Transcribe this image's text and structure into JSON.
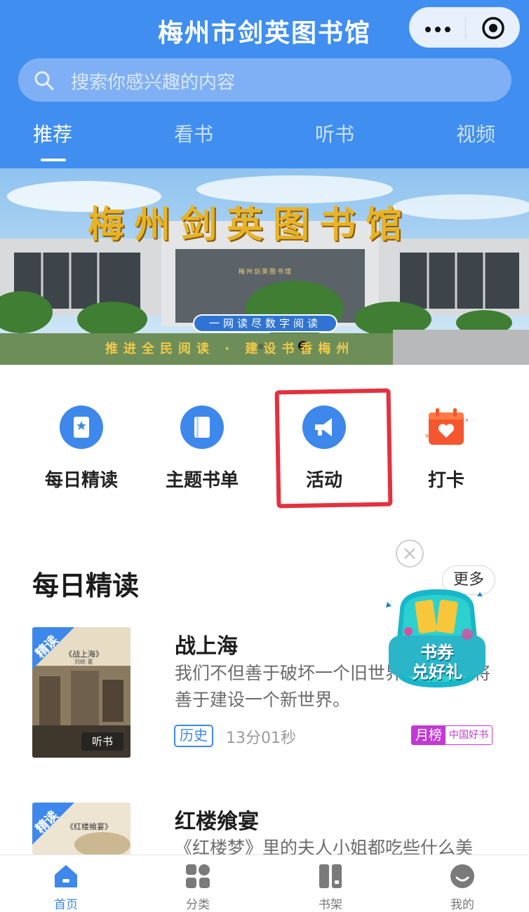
{
  "header": {
    "title": "梅州市剑英图书馆",
    "search_placeholder": "搜索你感兴趣的内容",
    "tabs": [
      "推荐",
      "看书",
      "听书",
      "视频"
    ],
    "active_tab": "推荐",
    "accent_color": "#3f8ef0"
  },
  "banner": {
    "headline": "梅州剑英图书馆",
    "building_sign": "梅州剑英图书馆",
    "pill": "一网读尽数字阅读",
    "slogan": "推进全民阅读 · 建设书香梅州"
  },
  "quick_links": [
    {
      "label": "每日精读",
      "icon": "book-star-icon"
    },
    {
      "label": "主题书单",
      "icon": "book-icon"
    },
    {
      "label": "活动",
      "icon": "megaphone-icon"
    },
    {
      "label": "打卡",
      "icon": "calendar-heart-icon"
    }
  ],
  "section": {
    "title": "每日精读",
    "more_label": "更多"
  },
  "books": [
    {
      "title": "战上海",
      "description": "我们不但善于破坏一个旧世界，我们还将善于建设一个新世界。",
      "ribbon": "精读",
      "cover_title": "《战上海》",
      "cover_author": "刘统 著",
      "cover_badge": "听书",
      "tag": "历史",
      "duration": "13分01秒",
      "rank_label": "月榜",
      "rank_source": "中国好书"
    },
    {
      "title": "红楼飨宴",
      "description": "《红楼梦》里的夫人小姐都吃些什么美",
      "ribbon": "精读",
      "cover_title": "《红楼飨宴》"
    }
  ],
  "promo": {
    "line1": "书券",
    "line2": "兑好礼"
  },
  "tabbar": [
    {
      "label": "首页",
      "icon": "home-icon",
      "active": true
    },
    {
      "label": "分类",
      "icon": "grid-icon",
      "active": false
    },
    {
      "label": "书架",
      "icon": "bookshelf-icon",
      "active": false
    },
    {
      "label": "我的",
      "icon": "profile-icon",
      "active": false
    }
  ]
}
